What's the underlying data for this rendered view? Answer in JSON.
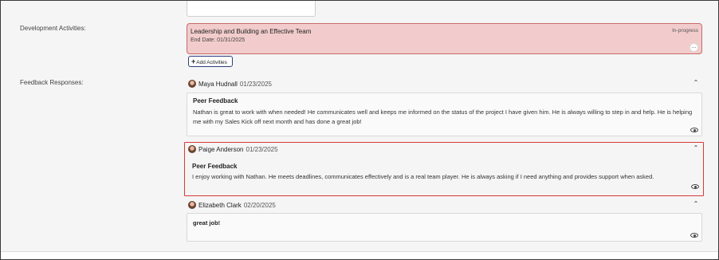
{
  "development": {
    "label": "Development Activities:",
    "activity": {
      "title": "Leadership and Building an Effective Team",
      "end_date": "End Date: 01/31/2025",
      "status": "In-progress",
      "more_label": "…"
    },
    "add_button": {
      "icon": "+",
      "label": "Add Activities"
    }
  },
  "feedback": {
    "label": "Feedback Responses:",
    "responses": [
      {
        "name": "Maya Hudnall",
        "date": "01/23/2025",
        "type": "Peer Feedback",
        "text": "Nathan is great to work with when needed! He communicates well and keeps me informed on the status of the project I have given him. He is always willing to step in and help. He is helping me with my Sales Kick off next month and has done a great job!"
      },
      {
        "name": "Paige Anderson",
        "date": "01/23/2025",
        "type": "Peer Feedback",
        "text": "I enjoy working with Nathan. He meets deadlines, communicates effectively and is a real team player. He is always asking if I need anything and provides support when asked."
      },
      {
        "name": "Elizabeth Clark",
        "date": "02/20/2025",
        "type": "",
        "text": "great job!"
      }
    ]
  },
  "icons": {
    "collapse": "chevron-up-icon",
    "view": "eye-icon",
    "more": "more-icon"
  },
  "colors": {
    "activity_bg": "#f2cccc",
    "activity_border": "#c96a6a",
    "highlight_border": "#d83a3a",
    "add_button_border": "#2d3f7a"
  }
}
